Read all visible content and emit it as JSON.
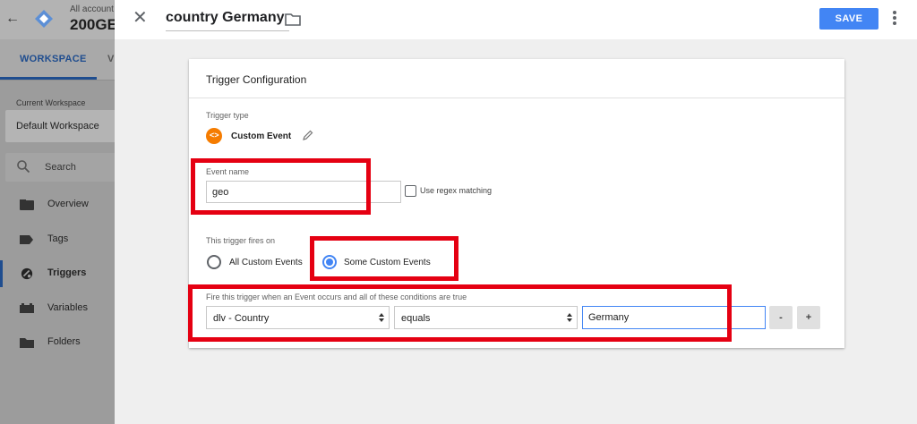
{
  "left_app": {
    "account_small": "All account",
    "account_big": "200GE",
    "tabs": {
      "workspace": "WORKSPACE",
      "versions_partial": "V"
    },
    "current_workspace_label": "Current Workspace",
    "workspace_name": "Default Workspace",
    "search_label": "Search",
    "nav": [
      {
        "label": "Overview",
        "icon": "overview-icon"
      },
      {
        "label": "Tags",
        "icon": "tag-icon"
      },
      {
        "label": "Triggers",
        "icon": "trigger-icon",
        "active": true
      },
      {
        "label": "Variables",
        "icon": "variables-icon"
      },
      {
        "label": "Folders",
        "icon": "folder-icon"
      }
    ]
  },
  "topbar": {
    "title": "country Germany",
    "save_label": "SAVE"
  },
  "card": {
    "title": "Trigger Configuration",
    "trigger_type_label": "Trigger type",
    "trigger_type_value": "Custom Event",
    "event_name_label": "Event name",
    "event_name_value": "geo",
    "regex_label": "Use regex matching",
    "fires_on_label": "This trigger fires on",
    "fires_on_options": [
      "All Custom Events",
      "Some Custom Events"
    ],
    "fires_on_selected": "Some Custom Events",
    "condition_label": "Fire this trigger when an Event occurs and all of these conditions are true",
    "condition": {
      "variable": "dlv - Country",
      "operator": "equals",
      "value": "Germany"
    },
    "remove_label": "-",
    "add_label": "+"
  },
  "colors": {
    "accent": "#4285f4",
    "annotation": "#e50012",
    "custom_event_icon": "#f57c00"
  }
}
